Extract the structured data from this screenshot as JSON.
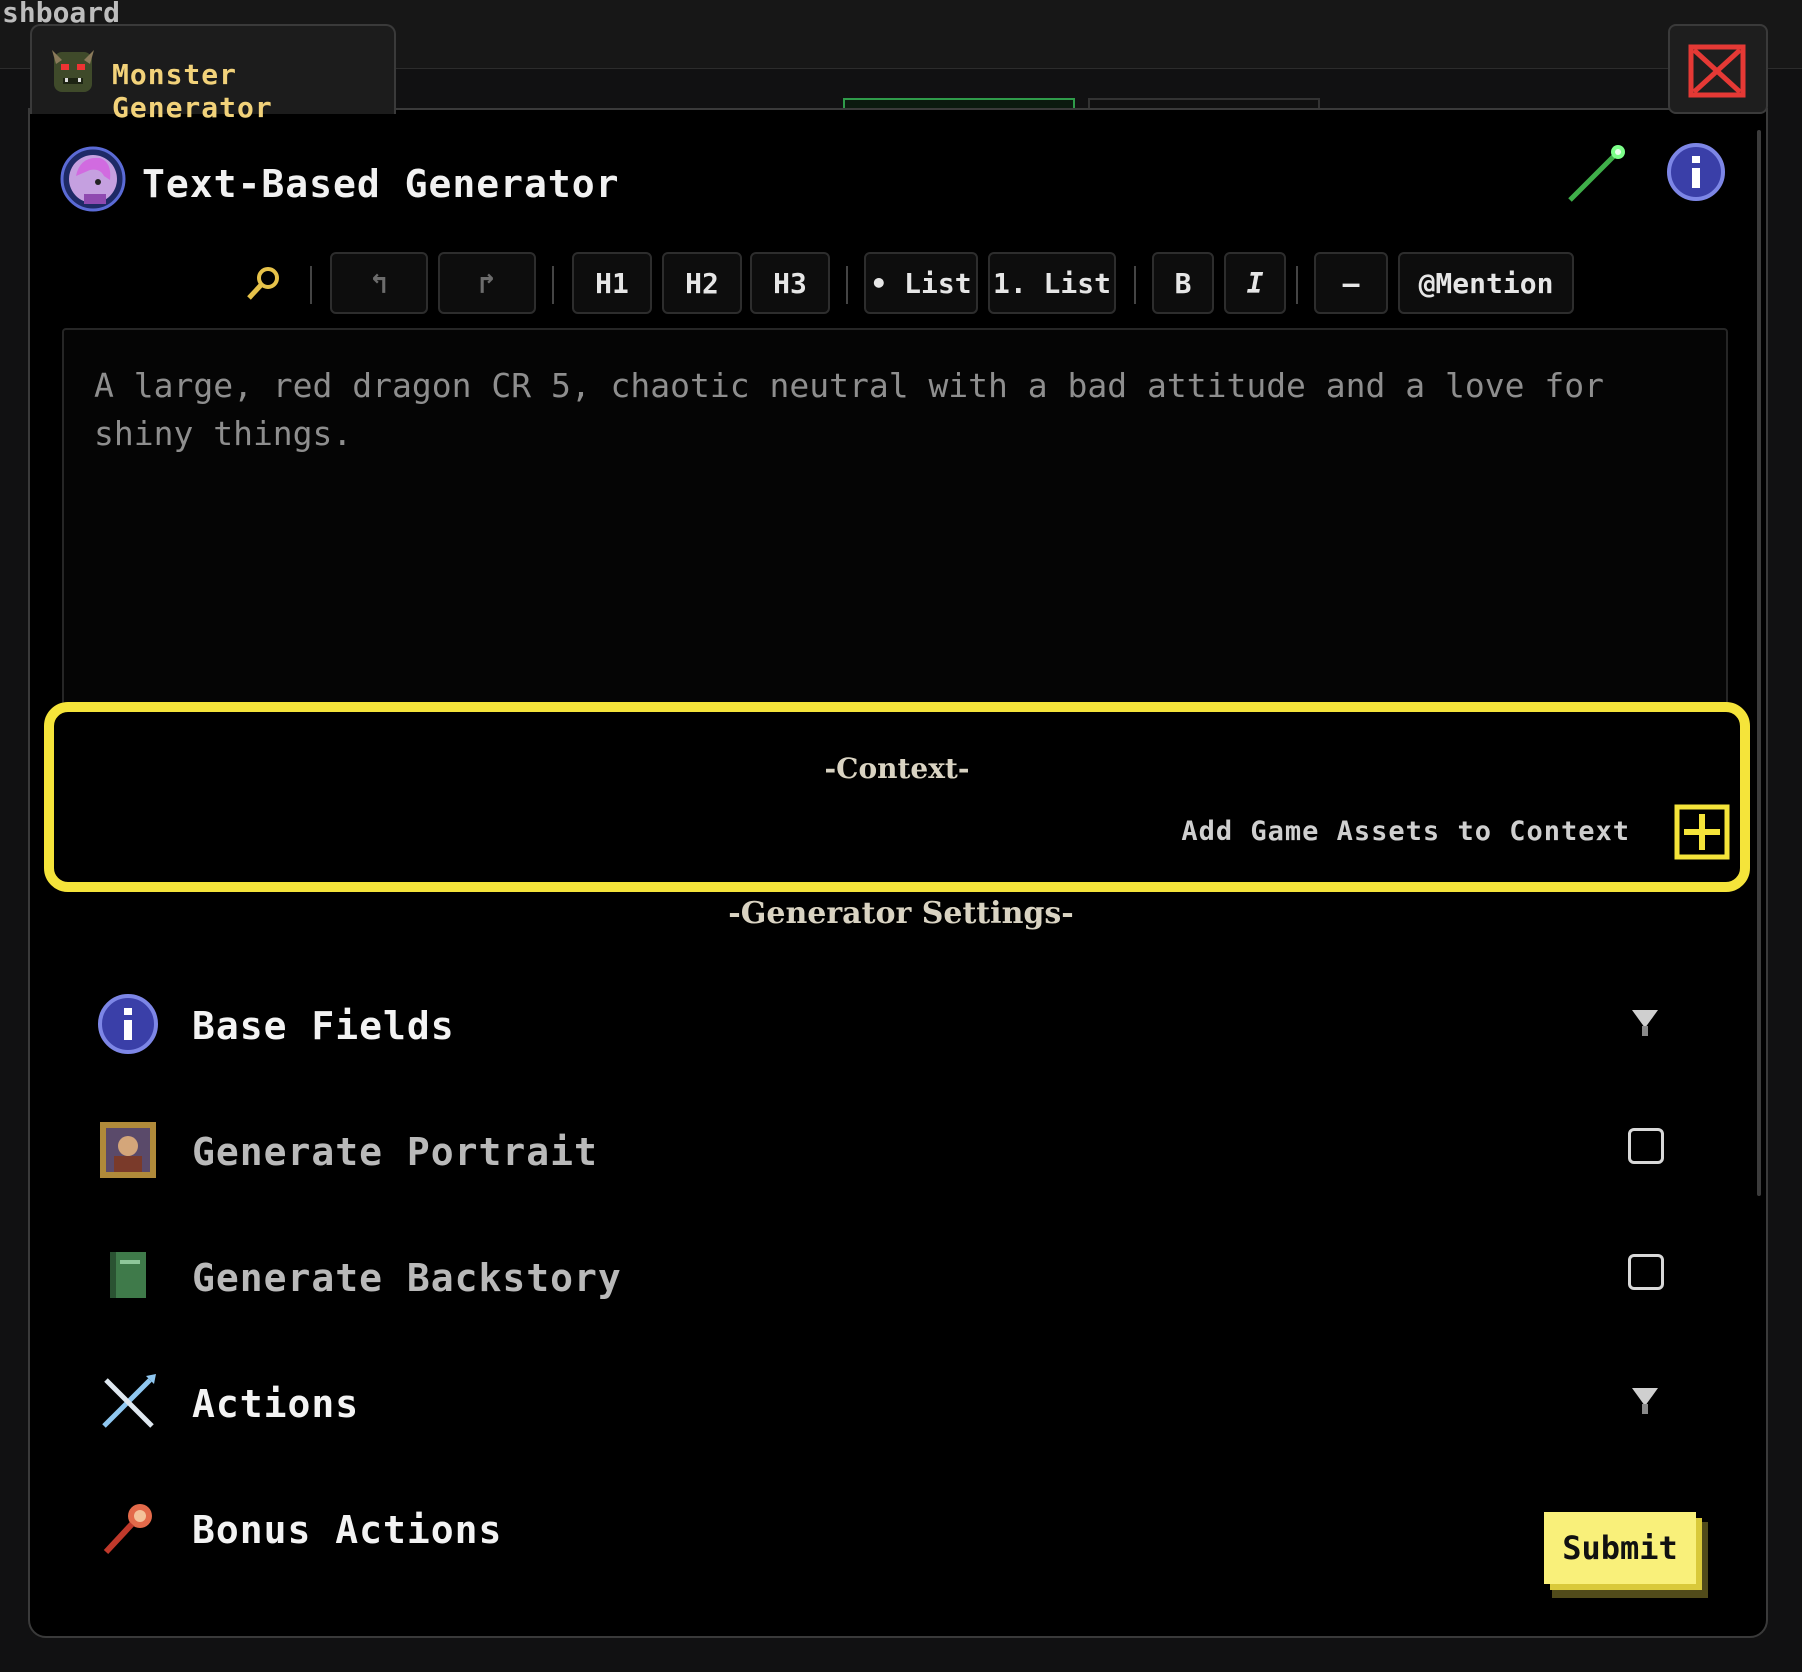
{
  "background_breadcrumb": "shboard",
  "window_tab": {
    "label": "Monster Generator",
    "icon": "monster-icon"
  },
  "close_icon": "close-icon",
  "generator": {
    "title": "Text-Based Generator",
    "icon": "elf-portrait-icon"
  },
  "header_actions": {
    "wand_icon": "magic-wand-icon",
    "info_icon": "info-icon"
  },
  "toolbar": {
    "search_icon": "search-icon",
    "undo": "↰",
    "redo": "↱",
    "h1": "H1",
    "h2": "H2",
    "h3": "H3",
    "bullet_list": "• List",
    "numbered_list": "1. List",
    "bold": "B",
    "italic": "I",
    "hr": "—",
    "mention": "@Mention"
  },
  "editor": {
    "placeholder": "A large, red dragon CR 5, chaotic neutral with a bad attitude and a love for shiny things."
  },
  "context": {
    "title": "-Context-",
    "add_label": "Add Game Assets to Context",
    "add_icon": "plus-icon"
  },
  "settings": {
    "title": "-Generator Settings-",
    "rows": [
      {
        "label": "Base Fields",
        "icon": "info-icon",
        "control": "chevron"
      },
      {
        "label": "Generate Portrait",
        "icon": "portrait-frame-icon",
        "control": "checkbox",
        "checked": false
      },
      {
        "label": "Generate Backstory",
        "icon": "book-icon",
        "control": "checkbox",
        "checked": false
      },
      {
        "label": "Actions",
        "icon": "crossed-swords-icon",
        "control": "chevron"
      },
      {
        "label": "Bonus Actions",
        "icon": "fireball-icon",
        "control": "none"
      }
    ]
  },
  "submit_label": "Submit",
  "colors": {
    "highlight": "#f5e43a",
    "accent_gold": "#f2d27a",
    "close_red": "#e53935",
    "submit": "#f9f07a"
  }
}
